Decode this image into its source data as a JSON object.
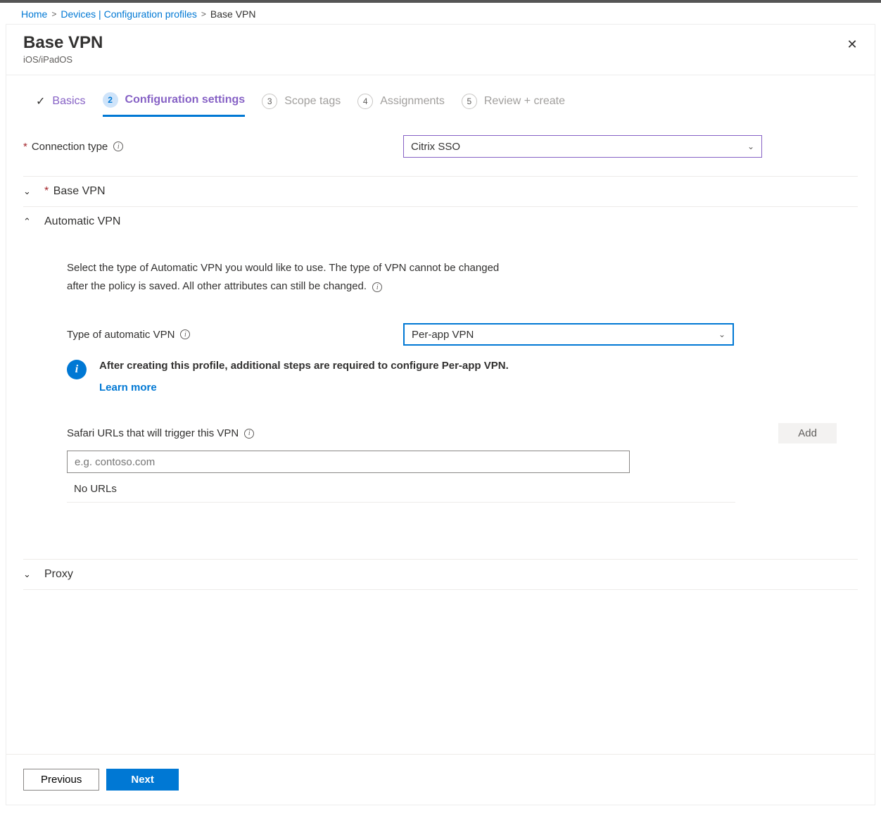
{
  "breadcrumb": {
    "home": "Home",
    "devices": "Devices | Configuration profiles",
    "current": "Base VPN"
  },
  "header": {
    "title": "Base VPN",
    "subtitle": "iOS/iPadOS"
  },
  "tabs": {
    "basics": "Basics",
    "config_num": "2",
    "config": "Configuration settings",
    "scope_num": "3",
    "scope": "Scope tags",
    "assign_num": "4",
    "assign": "Assignments",
    "review_num": "5",
    "review": "Review + create"
  },
  "fields": {
    "connection_type_label": "Connection type",
    "connection_type_value": "Citrix SSO"
  },
  "sections": {
    "base_vpn": "Base VPN",
    "automatic_vpn": "Automatic VPN",
    "proxy": "Proxy"
  },
  "auto_vpn": {
    "description": "Select the type of Automatic VPN you would like to use. The type of VPN cannot be changed after the policy is saved. All other attributes can still be changed.",
    "type_label": "Type of automatic VPN",
    "type_value": "Per-app VPN",
    "banner_text": "After creating this profile, additional steps are required to configure Per-app VPN.",
    "learn_more": "Learn more",
    "safari_label": "Safari URLs that will trigger this VPN",
    "add_label": "Add",
    "url_placeholder": "e.g. contoso.com",
    "no_urls": "No URLs"
  },
  "footer": {
    "previous": "Previous",
    "next": "Next"
  }
}
